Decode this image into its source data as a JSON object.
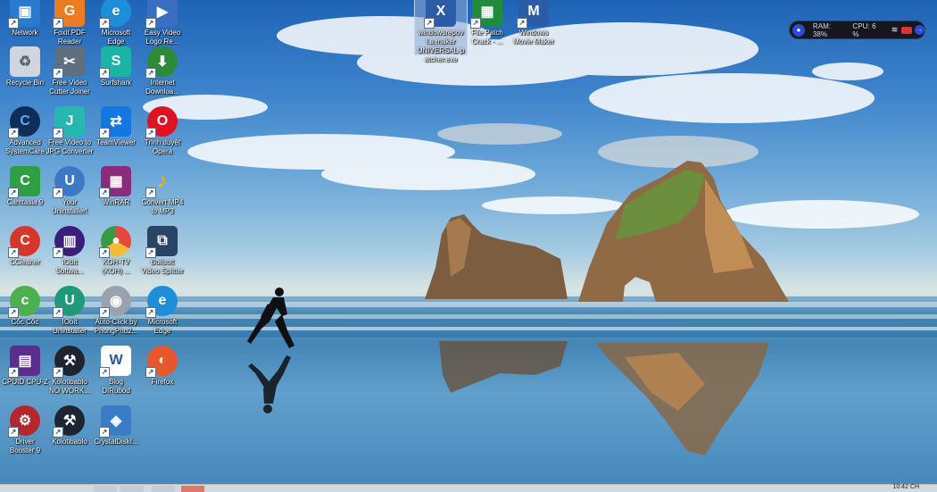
{
  "desktop": {
    "icons": [
      {
        "label": "Network",
        "icon": "network-icon",
        "color": "#2a7ad0"
      },
      {
        "label": "Foxit PDF\nReader",
        "icon": "pdf-reader-icon",
        "color": "#f07a20"
      },
      {
        "label": "Microsoft\nEdge",
        "icon": "edge-icon",
        "color": "#1c8fd8"
      },
      {
        "label": "Easy Video\nLogo Re...",
        "icon": "video-logo-icon",
        "color": "#3a6ec0"
      },
      {
        "label": "Recycle Bin",
        "icon": "recycle-bin-icon",
        "color": "#cfd6de"
      },
      {
        "label": "Free Video\nCutter Joiner",
        "icon": "video-cutter-icon",
        "color": "#5e6f80"
      },
      {
        "label": "Surfshark",
        "icon": "surfshark-icon",
        "color": "#1bb3a6"
      },
      {
        "label": "Internet\nDownloa...",
        "icon": "download-manager-icon",
        "color": "#2e8b35"
      },
      {
        "label": "Advanced\nSystemCare",
        "icon": "systemcare-icon",
        "color": "#0e2d57"
      },
      {
        "label": "Free Video to\nJPG Converter",
        "icon": "jpg-converter-icon",
        "color": "#28b6b0"
      },
      {
        "label": "TeamViewer",
        "icon": "teamviewer-icon",
        "color": "#1476e0"
      },
      {
        "label": "Trình duyệt\nOpera",
        "icon": "opera-icon",
        "color": "#e0121f"
      },
      {
        "label": "Camtasia 9",
        "icon": "camtasia-icon",
        "color": "#2ea043"
      },
      {
        "label": "Your\nUninstaller!",
        "icon": "uninstaller-icon",
        "color": "#3d78c8"
      },
      {
        "label": "WinRAR",
        "icon": "winrar-icon",
        "color": "#8a2b7c"
      },
      {
        "label": "Convert MP4\nto MP3",
        "icon": "music-note-icon",
        "color": "#e9b31b"
      },
      {
        "label": "CCleaner",
        "icon": "ccleaner-icon",
        "color": "#d8362a"
      },
      {
        "label": "IObit\nSoftwa...",
        "icon": "iobit-software-icon",
        "color": "#3b1e7a"
      },
      {
        "label": "KOH-TV\n(KOH) ...",
        "icon": "chrome-icon",
        "color": "#3a9a43"
      },
      {
        "label": "Boilsoft\nVideo Splitter",
        "icon": "video-splitter-icon",
        "color": "#2a4466"
      },
      {
        "label": "Cốc Cốc",
        "icon": "coccoc-icon",
        "color": "#4caf50"
      },
      {
        "label": "IObit\nUninstaller",
        "icon": "iobit-uninstaller-icon",
        "color": "#1c9a7a"
      },
      {
        "label": "Auto-Click by\nPhongPhu2...",
        "icon": "auto-click-icon",
        "color": "#9aa3ad"
      },
      {
        "label": "Microsoft\nEdge",
        "icon": "edge-icon",
        "color": "#1c8fd8"
      },
      {
        "label": "CPUID CPU-Z",
        "icon": "cpuz-icon",
        "color": "#5b2d8c"
      },
      {
        "label": "Kolotibablo\nNO WORK...",
        "icon": "hammer-icon",
        "color": "#1e2430"
      },
      {
        "label": "Blog\nDIRubod",
        "icon": "word-doc-icon",
        "color": "#2b5797"
      },
      {
        "label": "Firefox",
        "icon": "firefox-icon",
        "color": "#e8572a"
      },
      {
        "label": "Driver\nBooster 9",
        "icon": "driver-booster-icon",
        "color": "#b8262d"
      },
      {
        "label": "Kolotibablo",
        "icon": "hammer-icon",
        "color": "#1e2430"
      },
      {
        "label": "CrystalDiskI...",
        "icon": "crystaldisk-icon",
        "color": "#3a7cc5"
      }
    ],
    "top_icons": [
      {
        "label": "windowsrepov\nl.a.maker\nUNIVERSAL-p\natcher.exe",
        "icon": "patcher-icon",
        "color": "#2b5ca8",
        "selected": true
      },
      {
        "label": "File Patch\nCrack - ...",
        "icon": "patch-icon",
        "color": "#1f8b3b",
        "selected": false
      },
      {
        "label": "Windows\nMovie Maker",
        "icon": "movie-maker-icon",
        "color": "#2b5ca8",
        "selected": false
      }
    ]
  },
  "monitor": {
    "ram_label": "RAM: 38%",
    "cpu_label": "CPU: 6 %",
    "accent": "#2b4bd6",
    "record_color": "#e2312f"
  },
  "taskbar": {
    "clock": "10:42 CH"
  }
}
